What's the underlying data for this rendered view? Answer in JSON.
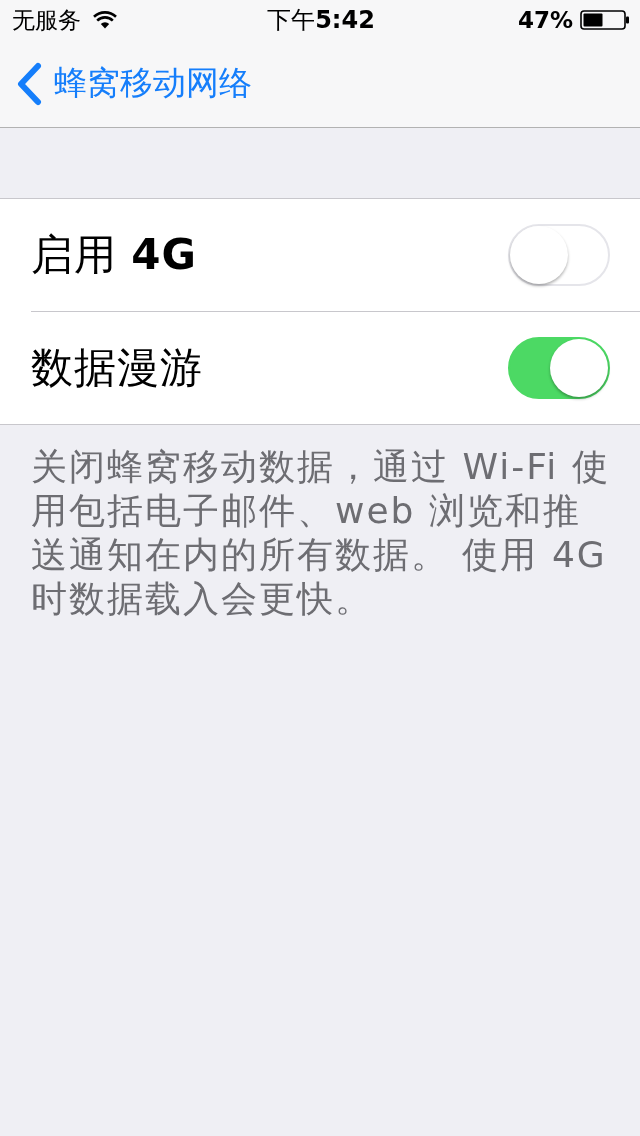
{
  "status_bar": {
    "carrier": "无服务",
    "time": "下午**5:42**",
    "battery": "47%"
  },
  "nav_bar": {
    "back_label": "蜂窝移动网络"
  },
  "settings": [
    {
      "label": "启用 **4G**",
      "on": false
    },
    {
      "label": "数据漫游",
      "on": true
    }
  ],
  "footer": "关闭蜂窝移动数据，通过 Wi-Fi 使用包括电子邮件、web 浏览和推送通知在内的所有数据。 使用 4G 时数据载入会更快。"
}
